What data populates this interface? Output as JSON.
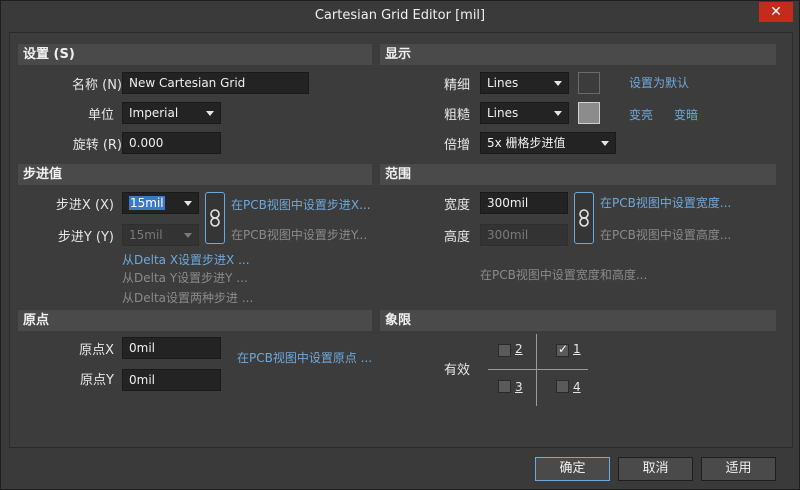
{
  "window": {
    "title": "Cartesian Grid Editor [mil]",
    "close_glyph": "✕"
  },
  "settings": {
    "header": "设置 (S)",
    "name_label": "名称 (N)",
    "name_value": "New Cartesian Grid",
    "unit_label": "单位",
    "unit_value": "Imperial",
    "rotation_label": "旋转 (R)",
    "rotation_value": "0.000"
  },
  "display": {
    "header": "显示",
    "fine_label": "精细",
    "fine_value": "Lines",
    "coarse_label": "粗糙",
    "coarse_value": "Lines",
    "multiplier_label": "倍增",
    "multiplier_value": "5x 栅格步进值",
    "set_default_link": "设置为默认",
    "lighten_link": "变亮",
    "darken_link": "变暗",
    "fine_color": "#3c3c3c",
    "coarse_color": "#8c8c8c"
  },
  "step": {
    "header": "步进值",
    "stepx_label": "步进X (X)",
    "stepx_value": "15mil",
    "stepy_label": "步进Y (Y)",
    "stepy_value": "15mil",
    "set_stepx_link": "在PCB视图中设置步进X...",
    "set_stepy_link": "在PCB视图中设置步进Y...",
    "delta_x_link": "从Delta X设置步进X ...",
    "delta_y_link": "从Delta Y设置步进Y ...",
    "delta_both_link": "从Delta设置两种步进 ..."
  },
  "range": {
    "header": "范围",
    "width_label": "宽度",
    "width_value": "300mil",
    "height_label": "高度",
    "height_value": "300mil",
    "set_width_link": "在PCB视图中设置宽度...",
    "set_height_link": "在PCB视图中设置高度...",
    "set_both_link": "在PCB视图中设置宽度和高度..."
  },
  "origin": {
    "header": "原点",
    "ox_label": "原点X",
    "ox_value": "0mil",
    "oy_label": "原点Y",
    "oy_value": "0mil",
    "set_origin_link": "在PCB视图中设置原点 ..."
  },
  "quadrant": {
    "header": "象限",
    "enabled_label": "有效",
    "q1_label": "1",
    "q2_label": "2",
    "q3_label": "3",
    "q4_label": "4",
    "q1_checked": true,
    "q2_checked": false,
    "q3_checked": false,
    "q4_checked": false
  },
  "buttons": {
    "ok": "确定",
    "cancel": "取消",
    "apply": "适用"
  }
}
